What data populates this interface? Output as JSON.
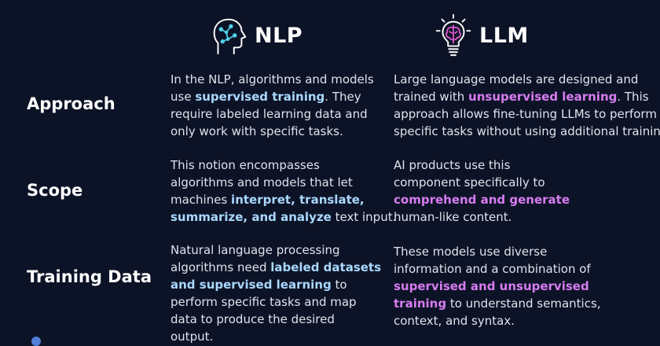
{
  "colors": {
    "background": "#0d1326",
    "nlp_accent": "#a9d8ff",
    "llm_accent": "#d77cf0",
    "text": "#dfe3ec"
  },
  "headers": {
    "nlp": {
      "icon": "brain-head-icon",
      "title": "NLP"
    },
    "llm": {
      "icon": "lightbulb-brain-icon",
      "title": "LLM"
    }
  },
  "rows": {
    "approach": {
      "label": "Approach",
      "nlp": {
        "l1": "In the NLP, algorithms and models",
        "l2a": "use ",
        "l2b": "supervised training",
        "l2c": ". They",
        "l3": "require labeled learning data and",
        "l4": "only work with specific tasks."
      },
      "llm": {
        "l1": "Large language models are designed and",
        "l2a": "trained with ",
        "l2b": "unsupervised learning",
        "l2c": ". This",
        "l3": "approach allows fine-tuning LLMs to perform",
        "l4": "specific tasks without using additional training"
      }
    },
    "scope": {
      "label": "Scope",
      "nlp": {
        "l1": "This notion encompasses",
        "l2": "algorithms and models that let",
        "l3a": "machines ",
        "l3b": "interpret, translate,",
        "l4a": "summarize, and analyze",
        "l4b": " text input."
      },
      "llm": {
        "l1": "AI products use this",
        "l2": "component specifically to",
        "l3": "comprehend and generate",
        "l4": "human-like content."
      }
    },
    "training": {
      "label": "Training Data",
      "nlp": {
        "l1": "Natural language processing",
        "l2a": "algorithms need ",
        "l2b": "labeled datasets",
        "l3a": "and supervised learning",
        "l3b": " to",
        "l4": "perform specific tasks and map",
        "l5": "data to produce the desired",
        "l6": "output."
      },
      "llm": {
        "l1": "These models use diverse",
        "l2": "information and a combination of",
        "l3": "supervised and unsupervised",
        "l4a": "training",
        "l4b": " to understand semantics,",
        "l5": "context, and syntax."
      }
    }
  }
}
